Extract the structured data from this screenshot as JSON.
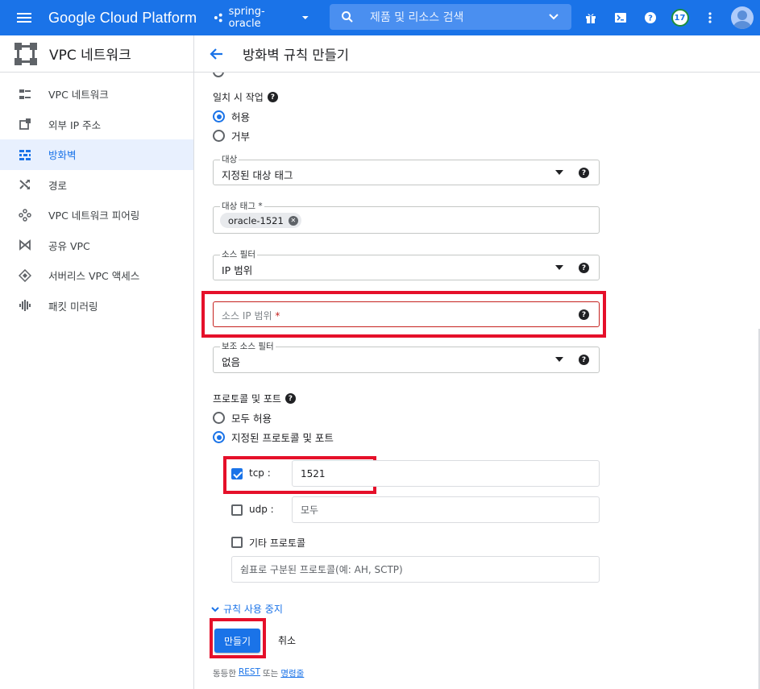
{
  "topbar": {
    "brand": "Google Cloud Platform",
    "project": "spring-oracle",
    "search_placeholder": "제품 및 리소스 검색",
    "notification_count": "17",
    "colors": {
      "bar": "#1a73e8"
    }
  },
  "sidebar": {
    "title": "VPC 네트워크",
    "items": [
      {
        "label": "VPC 네트워크",
        "icon": "vpc-network-icon",
        "active": false
      },
      {
        "label": "외부 IP 주소",
        "icon": "external-ip-icon",
        "active": false
      },
      {
        "label": "방화벽",
        "icon": "firewall-icon",
        "active": true
      },
      {
        "label": "경로",
        "icon": "routes-icon",
        "active": false
      },
      {
        "label": "VPC 네트워크 피어링",
        "icon": "peering-icon",
        "active": false
      },
      {
        "label": "공유 VPC",
        "icon": "shared-vpc-icon",
        "active": false
      },
      {
        "label": "서버리스 VPC 액세스",
        "icon": "serverless-icon",
        "active": false
      },
      {
        "label": "패킷 미러링",
        "icon": "packet-mirroring-icon",
        "active": false
      }
    ]
  },
  "header": {
    "title": "방화벽 규칙 만들기"
  },
  "form": {
    "action_on_match": {
      "label": "일치 시 작업",
      "options": [
        "허용",
        "거부"
      ],
      "selected": "허용"
    },
    "targets": {
      "label": "대상",
      "value": "지정된 대상 태그"
    },
    "target_tags": {
      "label": "대상 태그 *",
      "chip": "oracle-1521"
    },
    "source_filter": {
      "label": "소스 필터",
      "value": "IP 범위"
    },
    "source_ip": {
      "placeholder": "소스 IP 범위",
      "required_mark": "*"
    },
    "secondary_filter": {
      "label": "보조 소스 필터",
      "value": "없음"
    },
    "protocols": {
      "label": "프로토콜 및 포트",
      "options": [
        "모두 허용",
        "지정된 프로토콜 및 포트"
      ],
      "selected": "지정된 프로토콜 및 포트",
      "tcp": {
        "label": "tcp :",
        "checked": true,
        "value": "1521"
      },
      "udp": {
        "label": "udp :",
        "checked": false,
        "value": "모두"
      },
      "other": {
        "label": "기타 프로토콜",
        "checked": false,
        "placeholder": "쉼표로 구분된 프로토콜(예: AH, SCTP)"
      }
    },
    "disable_rule": "규칙 사용 중지",
    "create_button": "만들기",
    "cancel_button": "취소",
    "footer": {
      "prefix": "동등한",
      "rest": "REST",
      "or": "또는",
      "cmd": "명령줄"
    }
  }
}
